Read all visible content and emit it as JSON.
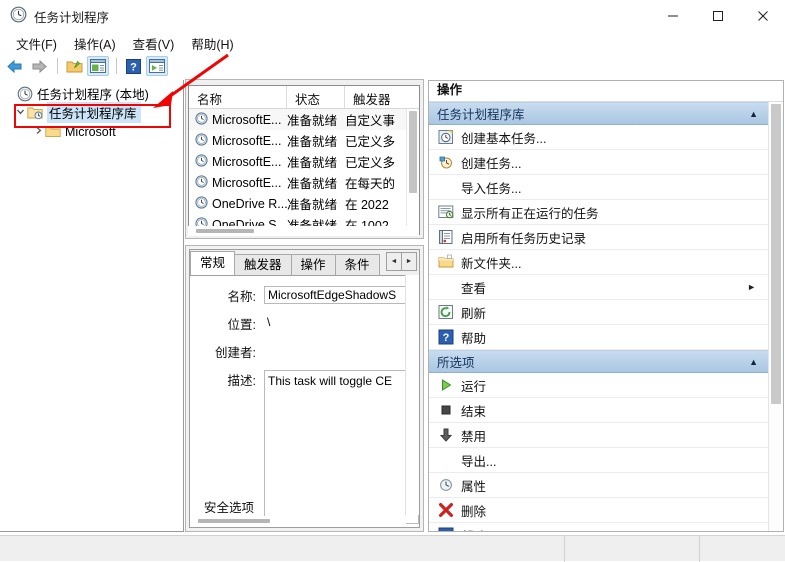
{
  "window": {
    "title": "任务计划程序",
    "icon": "clock-icon",
    "controls": {
      "minimize": "minimize-icon",
      "maximize": "maximize-icon",
      "close": "close-icon"
    }
  },
  "menubar": {
    "items": [
      {
        "label": "文件(F)",
        "name": "menu-file"
      },
      {
        "label": "操作(A)",
        "name": "menu-action"
      },
      {
        "label": "查看(V)",
        "name": "menu-view"
      },
      {
        "label": "帮助(H)",
        "name": "menu-help"
      }
    ]
  },
  "toolbar": {
    "items": [
      {
        "name": "back-arrow-icon",
        "icon": "arrow-left",
        "selected": false
      },
      {
        "name": "forward-arrow-icon",
        "icon": "arrow-right",
        "selected": false
      },
      {
        "name": "separator",
        "icon": "separator",
        "selected": false
      },
      {
        "name": "open-folder-icon",
        "icon": "folder-up",
        "selected": false
      },
      {
        "name": "show-console-tree-icon",
        "icon": "panel-left",
        "selected": true
      },
      {
        "name": "separator2",
        "icon": "separator",
        "selected": false
      },
      {
        "name": "help-icon",
        "icon": "question",
        "selected": false
      },
      {
        "name": "show-action-pane-icon",
        "icon": "panel-right",
        "selected": true
      }
    ]
  },
  "tree": {
    "nodes": [
      {
        "label": "任务计划程序 (本地)",
        "icon": "clock-icon",
        "level": 0,
        "expanded": false,
        "selected": false,
        "has_chevron": false
      },
      {
        "label": "任务计划程序库",
        "icon": "folder-clock-icon",
        "level": 1,
        "expanded": true,
        "selected": true,
        "has_chevron": true
      },
      {
        "label": "Microsoft",
        "icon": "folder-icon",
        "level": 2,
        "expanded": false,
        "selected": false,
        "has_chevron": true
      }
    ]
  },
  "task_list": {
    "columns": [
      {
        "label": "名称"
      },
      {
        "label": "状态"
      },
      {
        "label": "触发器"
      }
    ],
    "rows": [
      {
        "name": "MicrosoftE...",
        "status": "准备就绪",
        "trigger": "自定义事",
        "icon": "task-clock-icon",
        "selected": true
      },
      {
        "name": "MicrosoftE...",
        "status": "准备就绪",
        "trigger": "已定义多",
        "icon": "task-clock-icon",
        "selected": false
      },
      {
        "name": "MicrosoftE...",
        "status": "准备就绪",
        "trigger": "已定义多",
        "icon": "task-clock-icon",
        "selected": false
      },
      {
        "name": "MicrosoftE...",
        "status": "准备就绪",
        "trigger": "在每天的",
        "icon": "task-clock-icon",
        "selected": false
      },
      {
        "name": "OneDrive R...",
        "status": "准备就绪",
        "trigger": "在 2022",
        "icon": "task-clock-icon",
        "selected": false
      },
      {
        "name": "OneDrive S...",
        "status": "准备就绪",
        "trigger": "在 1002",
        "icon": "task-clock-icon",
        "selected": false
      }
    ]
  },
  "detail": {
    "tabs": [
      {
        "label": "常规",
        "active": true
      },
      {
        "label": "触发器",
        "active": false
      },
      {
        "label": "操作",
        "active": false
      },
      {
        "label": "条件",
        "active": false
      }
    ],
    "tab_scroll_left": "◄",
    "tab_scroll_right": "►",
    "fields": {
      "name_label": "名称:",
      "name_value": "MicrosoftEdgeShadowS",
      "location_label": "位置:",
      "location_value": "\\",
      "author_label": "创建者:",
      "author_value": "",
      "description_label": "描述:",
      "description_value": "This task will toggle CE"
    },
    "footer_label": "安全选项"
  },
  "actions": {
    "title": "操作",
    "sections": [
      {
        "title": "任务计划程序库",
        "collapse_icon": "caret-up-icon",
        "items": [
          {
            "label": "创建基本任务...",
            "icon": "create-basic-task-icon"
          },
          {
            "label": "创建任务...",
            "icon": "create-task-icon"
          },
          {
            "label": "导入任务...",
            "icon": "none"
          },
          {
            "label": "显示所有正在运行的任务",
            "icon": "running-tasks-icon"
          },
          {
            "label": "启用所有任务历史记录",
            "icon": "history-icon"
          },
          {
            "label": "新文件夹...",
            "icon": "new-folder-icon"
          },
          {
            "label": "查看",
            "icon": "none",
            "submenu": "►"
          },
          {
            "label": "刷新",
            "icon": "refresh-icon"
          },
          {
            "label": "帮助",
            "icon": "help-icon"
          }
        ]
      },
      {
        "title": "所选项",
        "collapse_icon": "caret-up-icon",
        "items": [
          {
            "label": "运行",
            "icon": "run-icon"
          },
          {
            "label": "结束",
            "icon": "stop-icon"
          },
          {
            "label": "禁用",
            "icon": "disable-icon"
          },
          {
            "label": "导出...",
            "icon": "none"
          },
          {
            "label": "属性",
            "icon": "properties-icon"
          },
          {
            "label": "删除",
            "icon": "delete-icon"
          },
          {
            "label": "帮助",
            "icon": "help-icon"
          }
        ]
      }
    ]
  },
  "statusbar": {
    "cells": [
      "",
      "",
      ""
    ]
  },
  "annotation": {
    "highlight_target": "任务计划程序库",
    "color": "#f00505"
  },
  "colors": {
    "selection": "#cce4f7",
    "section_header": "#a9c6e3",
    "annotation": "#f00505",
    "toolbar_selected": "#d6eaf8"
  }
}
